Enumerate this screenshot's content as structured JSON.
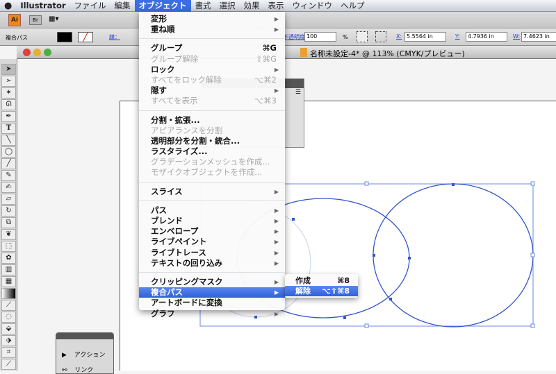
{
  "menubar": {
    "items": [
      "Illustrator",
      "ファイル",
      "編集",
      "オブジェクト",
      "書式",
      "選択",
      "効果",
      "表示",
      "ウィンドウ",
      "ヘルプ"
    ],
    "active": "オブジェクト"
  },
  "approw": {
    "ai_label": "Ai",
    "br_label": "Br"
  },
  "control": {
    "selection_label": "複合パス",
    "stroke_label": "線：",
    "opacity_label": "不透明度：",
    "opacity_value": "100",
    "opacity_unit": "%",
    "x_label": "X:",
    "x_value": "5.5564 in",
    "y_label": "Y:",
    "y_value": "4.7936 in",
    "w_label": "W:",
    "w_value": "7.4623 in"
  },
  "document": {
    "title": "名称未設定-4* @ 113% (CMYK/プレビュー)"
  },
  "menu": {
    "items": [
      {
        "label": "変形",
        "submenu": true
      },
      {
        "label": "重ね順",
        "submenu": true
      },
      {
        "sep": true
      },
      {
        "label": "グループ",
        "shortcut": "⌘G"
      },
      {
        "label": "グループ解除",
        "shortcut": "⇧⌘G",
        "disabled": true
      },
      {
        "label": "ロック",
        "submenu": true
      },
      {
        "label": "すべてをロック解除",
        "shortcut": "⌥⌘2",
        "disabled": true
      },
      {
        "label": "隠す",
        "submenu": true
      },
      {
        "label": "すべてを表示",
        "shortcut": "⌥⌘3",
        "disabled": true
      },
      {
        "sep": true
      },
      {
        "label": "分割・拡張..."
      },
      {
        "label": "アピアランスを分割",
        "disabled": true
      },
      {
        "label": "透明部分を分割・統合..."
      },
      {
        "label": "ラスタライズ..."
      },
      {
        "label": "グラデーションメッシュを作成...",
        "disabled": true
      },
      {
        "label": "モザイクオブジェクトを作成...",
        "disabled": true
      },
      {
        "sep": true
      },
      {
        "label": "スライス",
        "submenu": true
      },
      {
        "sep": true
      },
      {
        "label": "パス",
        "submenu": true
      },
      {
        "label": "ブレンド",
        "submenu": true
      },
      {
        "label": "エンベロープ",
        "submenu": true
      },
      {
        "label": "ライブペイント",
        "submenu": true
      },
      {
        "label": "ライブトレース",
        "submenu": true
      },
      {
        "label": "テキストの回り込み",
        "submenu": true
      },
      {
        "sep": true
      },
      {
        "label": "クリッピングマスク",
        "submenu": true
      },
      {
        "label": "複合パス",
        "submenu": true,
        "highlighted": true
      },
      {
        "label": "アートボードに変換"
      },
      {
        "label": "グラフ",
        "submenu": true
      }
    ]
  },
  "submenu": {
    "items": [
      {
        "label": "作成",
        "shortcut": "⌘8"
      },
      {
        "label": "解除",
        "shortcut": "⌥⇧⌘8",
        "highlighted": true
      }
    ]
  },
  "actions_panel": {
    "items": [
      "アクション",
      "リンク"
    ]
  },
  "colors": {
    "accent": "#3b6ee3",
    "path": "#3355cc"
  }
}
